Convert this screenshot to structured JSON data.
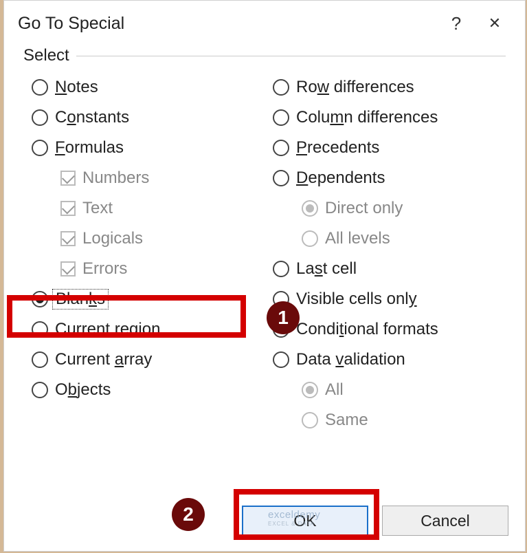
{
  "titlebar": {
    "title": "Go To Special",
    "help": "?",
    "close": "✕"
  },
  "fieldset_label": "Select",
  "left": {
    "notes": "otes",
    "constants": "nstants",
    "formulas": "ormulas",
    "numbers": "Numbers",
    "text": "Text",
    "logicals": "Logicals",
    "errors": "Errors",
    "blanks": "s",
    "current_region": "Current r",
    "current_region2": "gion",
    "current_array": "Current ",
    "current_array2": "rray",
    "objects": "O",
    "objects2": "jects"
  },
  "right": {
    "row_diff": "Ro",
    "row_diff2": " differences",
    "col_diff": "Colu",
    "col_diff2": "n differences",
    "precedents": "recedents",
    "dependents": "ependents",
    "direct_only": "Direct only",
    "all_levels": "All levels",
    "last_cell": "La",
    "last_cell2": "t cell",
    "visible": "Visible cells onl",
    "conditional": "Condi",
    "conditional2": "ional formats",
    "data_validation": "Data ",
    "data_validation2": "alidation",
    "all": "All",
    "same": "Same"
  },
  "buttons": {
    "ok": "K",
    "cancel": "Cancel"
  },
  "annotations": {
    "badge1": "1",
    "badge2": "2"
  },
  "watermark": {
    "main": "exceldemy",
    "sub": "EXCEL & DATA"
  }
}
